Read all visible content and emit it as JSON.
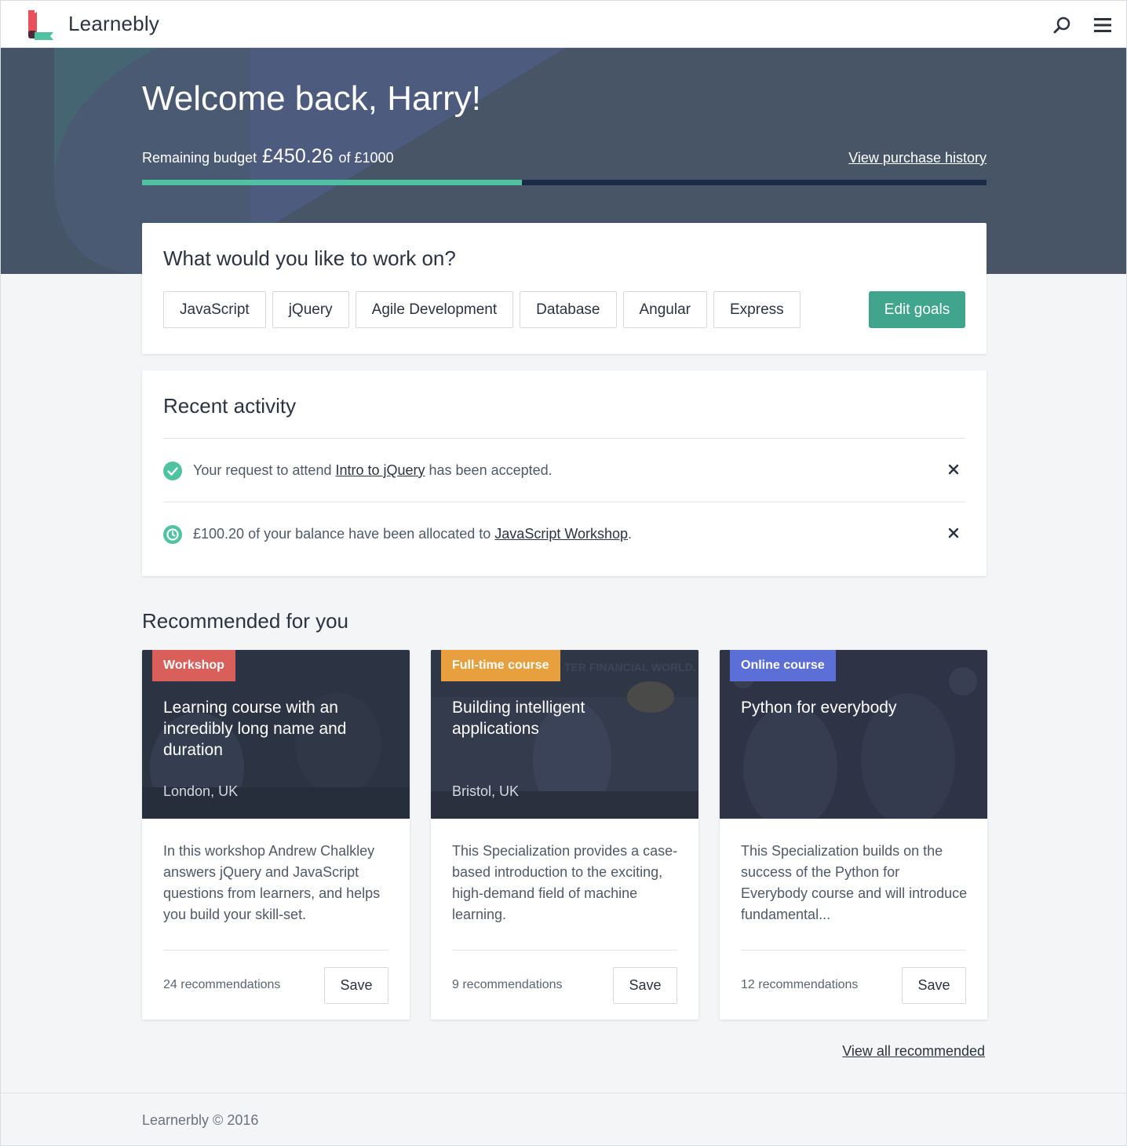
{
  "app": {
    "brand": "Learnebly"
  },
  "header": {
    "search_icon": "search-icon",
    "menu_icon": "hamburger-menu-icon"
  },
  "hero": {
    "welcome": "Welcome back, Harry!",
    "budget_label": "Remaining budget",
    "budget_amount": "£450.26",
    "budget_total": "of £1000",
    "budget_fraction": 0.45026,
    "history_link": "View purchase history"
  },
  "goals": {
    "title": "What would you like to work on?",
    "tags": [
      "JavaScript",
      "jQuery",
      "Agile Development",
      "Database",
      "Angular",
      "Express"
    ],
    "edit_label": "Edit goals"
  },
  "activity": {
    "title": "Recent activity",
    "items": [
      {
        "icon": "check-circle-icon",
        "before": "Your request to attend ",
        "link": "Intro to jQuery",
        "after": " has been accepted."
      },
      {
        "icon": "clock-circle-icon",
        "before": "£100.20 of your balance have been allocated to ",
        "link": "JavaScript Workshop",
        "after": "."
      }
    ]
  },
  "recommended": {
    "title": "Recommended for you",
    "courses": [
      {
        "badge": "Workshop",
        "name": "Learning course with an incredibly long name and duration",
        "location": "London, UK",
        "description": "In this workshop Andrew Chalkley answers jQuery and JavaScript questions from learners, and helps you build your skill-set.",
        "recommendations": "24 recommendations",
        "save": "Save"
      },
      {
        "badge": "Full-time course",
        "name": "Building intelligent applications",
        "location": "Bristol, UK",
        "image_caption": "TER FINANCIAL WORLD.",
        "description": "This Specialization provides a case-based introduction to the exciting, high-demand field of machine learning.",
        "recommendations": "9 recommendations",
        "save": "Save"
      },
      {
        "badge": "Online course",
        "name": "Python for everybody",
        "location": "",
        "description": "This Specialization builds on the success of the Python for Everybody course and will introduce fundamental...",
        "recommendations": "12 recommendations",
        "save": "Save"
      }
    ],
    "view_all": "View all recommended"
  },
  "footer": {
    "text": "Learnerbly ©  2016"
  },
  "colors": {
    "accent": "#41a58e",
    "progress": "#4fc3a1",
    "hero_bg": "#465468",
    "badge_workshop": "#d9605a",
    "badge_fulltime": "#e8a03f",
    "badge_online": "#5c6fd6"
  }
}
